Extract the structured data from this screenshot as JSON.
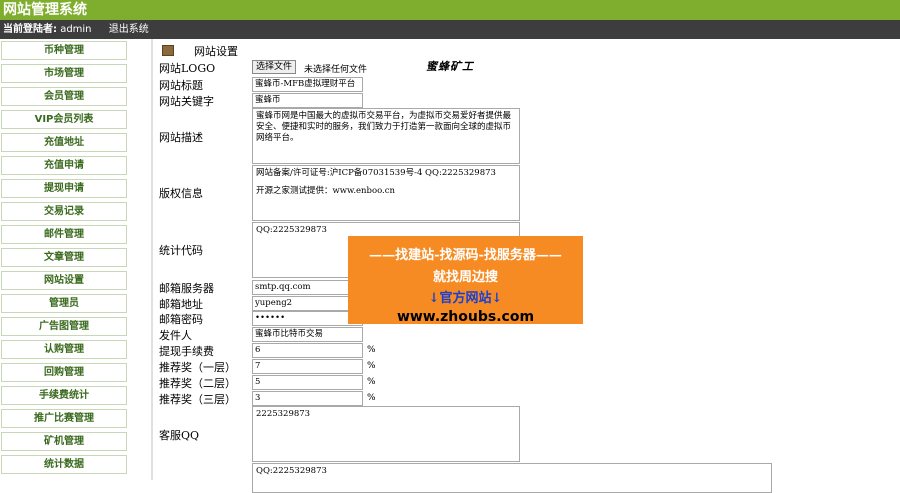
{
  "header": {
    "title": "网站管理系统"
  },
  "userbar": {
    "label": "当前登陆者:",
    "user": "admin",
    "logout": "退出系统"
  },
  "sidebar": {
    "items": [
      {
        "label": "币种管理"
      },
      {
        "label": "市场管理"
      },
      {
        "label": "会员管理"
      },
      {
        "label": "VIP会员列表"
      },
      {
        "label": "充值地址"
      },
      {
        "label": "充值申请"
      },
      {
        "label": "提现申请"
      },
      {
        "label": "交易记录"
      },
      {
        "label": "邮件管理"
      },
      {
        "label": "文章管理"
      },
      {
        "label": "网站设置"
      },
      {
        "label": "管理员"
      },
      {
        "label": "广告图管理"
      },
      {
        "label": "认购管理"
      },
      {
        "label": "回购管理"
      },
      {
        "label": "手续费统计"
      },
      {
        "label": "推广比赛管理"
      },
      {
        "label": "矿机管理"
      },
      {
        "label": "统计数据"
      }
    ]
  },
  "breadcrumb": {
    "title": "网站设置"
  },
  "form": {
    "logo_label": "网站LOGO",
    "file_button": "选择文件",
    "file_status": "未选择任何文件",
    "logo_text": "蜜蜂矿工",
    "site_title_label": "网站标题",
    "site_title_value": "蜜蜂币-MFB虚拟理财平台",
    "keywords_label": "网站关键字",
    "keywords_value": "蜜蜂币",
    "desc_label": "网站描述",
    "desc_value": "蜜蜂币网是中国最大的虚拟币交易平台，为虚拟币交易爱好者提供最安全、便捷和实时的服务，我们致力于打造第一款面向全球的虚拟币网络平台。",
    "copyright_label": "版权信息",
    "copyright_line1": "网站备案/许可证号:沪ICP备07031539号-4 QQ:2225329873",
    "copyright_line2": "开源之家测试提供：www.enboo.cn",
    "stats_label": "统计代码",
    "stats_value": "QQ:2225329873",
    "smtp_label": "邮箱服务器",
    "smtp_value": "smtp.qq.com",
    "email_label": "邮箱地址",
    "email_value": "yupeng2",
    "password_label": "邮箱密码",
    "password_value": "••••••",
    "sender_label": "发件人",
    "sender_value": "蜜蜂币比特币交易",
    "fee_label": "提现手续费",
    "fee_value": "6",
    "ref1_label": "推荐奖（一层）",
    "ref1_value": "7",
    "ref2_label": "推荐奖（二层）",
    "ref2_value": "5",
    "ref3_label": "推荐奖（三层）",
    "ref3_value": "3",
    "percent": "%",
    "qq_label": "客服QQ",
    "qq_value": "2225329873",
    "bottom_value": "QQ:2225329873"
  },
  "ad": {
    "line1": "——找建站-找源码-找服务器——",
    "line2": "就找周边搜",
    "line3": "↓官方网站↓",
    "line4": "www.zhoubs.com"
  },
  "colors": {
    "topbar": "#7fae2e",
    "userbar": "#3d3d3d",
    "ad": "#f78b23",
    "sidebar_text": "#3a6a1e"
  }
}
